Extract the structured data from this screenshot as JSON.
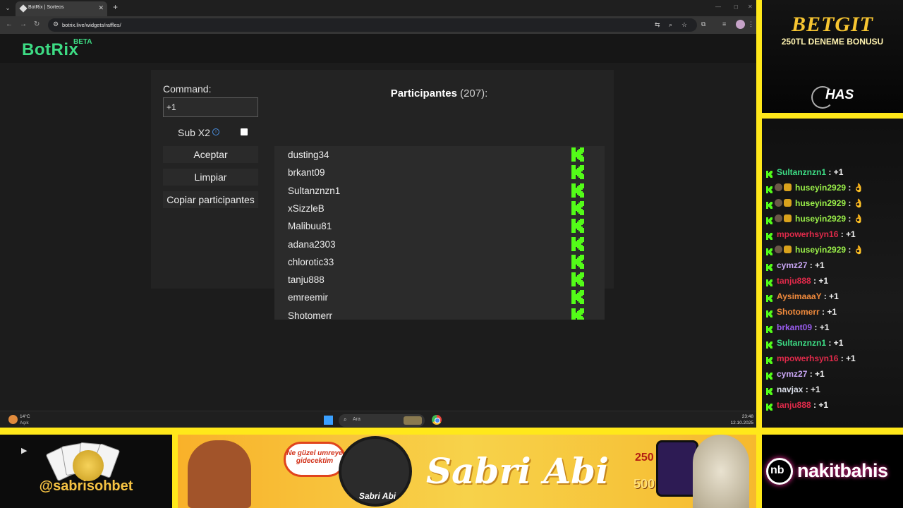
{
  "browser": {
    "tab": {
      "title": "BotRix | Sorteos"
    },
    "url": "botrix.live/widgets/raffles/"
  },
  "app": {
    "logo": "BotRix",
    "logo_badge": "BETA"
  },
  "raffle": {
    "command_label": "Command:",
    "command_value": "+1",
    "sub_x2_label": "Sub X2",
    "sub_x2_checked": false,
    "accept_label": "Aceptar",
    "clear_label": "Limpiar",
    "copy_label": "Copiar participantes",
    "participants_title": "Participantes",
    "participants_count": "(207):",
    "participants": [
      "dusting34",
      "brkant09",
      "Sultanznzn1",
      "xSizzleB",
      "Malibuu81",
      "adana2303",
      "chlorotic33",
      "tanju888",
      "emreemir",
      "Shotomerr"
    ],
    "platform_icon": "kick-icon"
  },
  "taskbar": {
    "weather_temp": "14°C",
    "weather_desc": "Açık",
    "search_placeholder": "Ara",
    "time": "23:48",
    "date": "12.10.2025"
  },
  "overlay": {
    "sponsor_top": {
      "brand": "BETGIT",
      "tagline": "250TL DENEME BONUSU",
      "partner": "HAS"
    },
    "chat": [
      {
        "user": "Sultanznzn1",
        "msg": " : +1",
        "color": "#3ddc84",
        "badges": false
      },
      {
        "user": "huseyin2929",
        "msg": " : 👌",
        "color": "#9cf24a",
        "badges": true
      },
      {
        "user": "huseyin2929",
        "msg": " : 👌",
        "color": "#9cf24a",
        "badges": true
      },
      {
        "user": "huseyin2929",
        "msg": " : 👌",
        "color": "#9cf24a",
        "badges": true
      },
      {
        "user": "mpowerhsyn16",
        "msg": " : +1",
        "color": "#e02a4a",
        "badges": false
      },
      {
        "user": "huseyin2929",
        "msg": " : 👌",
        "color": "#9cf24a",
        "badges": true
      },
      {
        "user": "cymz27",
        "msg": " : +1",
        "color": "#c9a6f5",
        "badges": false
      },
      {
        "user": "tanju888",
        "msg": " : +1",
        "color": "#e02a4a",
        "badges": false
      },
      {
        "user": "AysimaaaY",
        "msg": " : +1",
        "color": "#f08a3c",
        "badges": false
      },
      {
        "user": "Shotomerr",
        "msg": " : +1",
        "color": "#f08a3c",
        "badges": false
      },
      {
        "user": "brkant09",
        "msg": " : +1",
        "color": "#9a5cf0",
        "badges": false
      },
      {
        "user": "Sultanznzn1",
        "msg": " : +1",
        "color": "#3ddc84",
        "badges": false
      },
      {
        "user": "mpowerhsyn16",
        "msg": " : +1",
        "color": "#e02a4a",
        "badges": false
      },
      {
        "user": "cymz27",
        "msg": " : +1",
        "color": "#c9a6f5",
        "badges": false
      },
      {
        "user": "navjax",
        "msg": " : +1",
        "color": "#d9dde8",
        "badges": false
      },
      {
        "user": "tanju888",
        "msg": " : +1",
        "color": "#e02a4a",
        "badges": false
      }
    ],
    "handle": "@sabrisohbet",
    "speech_bubble": "Ne güzel umreye gidecektim",
    "portrait_name": "Sabri Abi",
    "banner_title": "Sabri Abi",
    "slot_250": "250",
    "slot_500": "500",
    "sponsor_bottom": {
      "short": "nb",
      "brand": "nakitbahis"
    }
  },
  "colors": {
    "brand_green": "#3ddc84",
    "kick_green": "#53fc18",
    "frame_yellow": "#ffe81a"
  }
}
